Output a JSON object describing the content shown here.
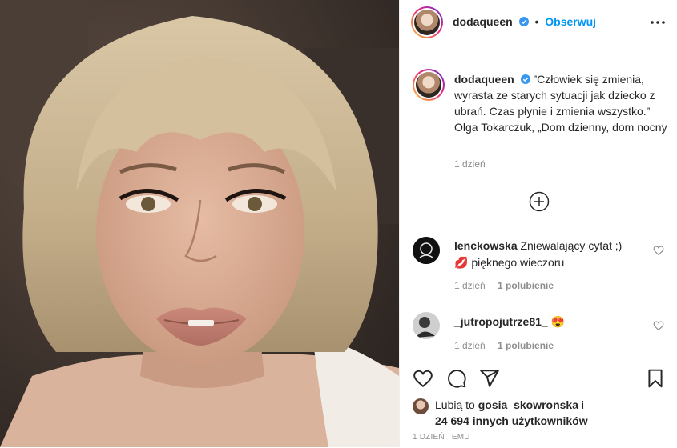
{
  "post": {
    "author": "dodaqueen",
    "follow_label": "Obserwuj",
    "separator": "•",
    "caption": "”Człowiek się zmienia, wyrasta ze starych sytuacji jak dziecko z ubrań. Czas płynie i zmienia wszystko.” Olga Tokarczuk, „Dom dzienny, dom nocny",
    "caption_time": "1 dzień",
    "photo_description_icon": "selfie-photo"
  },
  "comments": [
    {
      "user": "lenckowska",
      "text": "Zniewalający cytat ;)",
      "emoji": "💋",
      "text2": "pięknego wieczoru",
      "time": "1 dzień",
      "likes": "1 polubienie"
    },
    {
      "user": "_jutropojutrze81_",
      "emoji": "😍",
      "time": "1 dzień",
      "likes": "1 polubienie"
    }
  ],
  "likes": {
    "prefix": "Lubią to",
    "user": "gosia_skowronska",
    "connector": "i",
    "count": "24 694 innych użytkowników"
  },
  "timestamp": "1 DZIEŃ TEMU",
  "icons": {
    "verified": "verified-badge-icon",
    "more": "more-options-icon",
    "load_more": "load-more-comments-icon",
    "like": "heart-icon",
    "comment": "comment-icon",
    "share": "share-icon",
    "save": "bookmark-icon"
  },
  "colors": {
    "accent": "#0095f6",
    "verified": "#3897f0",
    "meta": "#8e8e8e"
  }
}
